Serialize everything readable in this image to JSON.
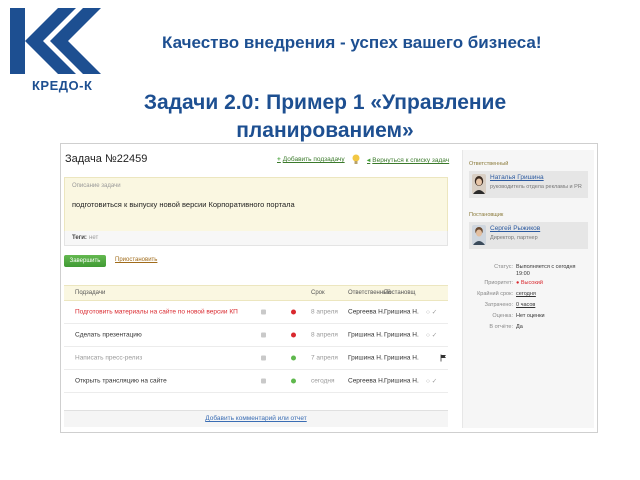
{
  "slide": {
    "logo_text": "КРЕДО-К",
    "slogan": "Качество внедрения - успех вашего бизнеса!",
    "title": "Задачи 2.0: Пример 1 «Управление планированием»"
  },
  "task": {
    "title": "Задача №22459",
    "add_subtask": "Добавить подзадачу",
    "back_to_list": "Вернуться к списку задач",
    "description_label": "Описание задачи",
    "description": "подготовиться к выпуску новой версии Корпоративного портала",
    "tags_label": "Теги:",
    "tags_value": "нет",
    "finish_button": "Завершить",
    "postpone_link": "Приостановить",
    "add_comment": "Добавить комментарий или отчет"
  },
  "subtasks": {
    "headers": {
      "name": "Подзадачи",
      "deadline": "Срок",
      "responsible": "Ответственный",
      "setter": "Постановщ"
    },
    "rows": [
      {
        "name": "Подготовить материалы на сайте по новой версии КП",
        "deadline": "8 апреля",
        "responsible": "Сергеева Н.",
        "setter": "Гришина Н.",
        "status_color": "red",
        "style": "red",
        "flag": false
      },
      {
        "name": "Сделать презентацию",
        "deadline": "8 апреля",
        "responsible": "Гришина Н.",
        "setter": "Гришина Н.",
        "status_color": "red",
        "style": "dark",
        "flag": false
      },
      {
        "name": "Написать пресс-релиз",
        "deadline": "7 апреля",
        "responsible": "Гришина Н.",
        "setter": "Гришина Н.",
        "status_color": "green",
        "style": "gray",
        "flag": true
      },
      {
        "name": "Открыть трансляцию на сайте",
        "deadline": "сегодня",
        "responsible": "Сергеева Н.",
        "setter": "Гришина Н.",
        "status_color": "green",
        "style": "dark",
        "flag": false
      }
    ]
  },
  "sidebar": {
    "responsible_label": "Ответственный",
    "responsible_name": "Наталья Гришина",
    "responsible_role": "руководитель отдела рекламы и PR",
    "setter_label": "Постановщик",
    "setter_name": "Сергей Рыжиков",
    "setter_role": "Директор, партнер",
    "props": [
      {
        "key": "Статус:",
        "value": "Выполняется с сегодня 19:00",
        "style": "plain"
      },
      {
        "key": "Приоритет:",
        "value": "● Высокий",
        "style": "red"
      },
      {
        "key": "Крайний срок:",
        "value": "сегодня",
        "style": "link"
      },
      {
        "key": "Затрачено:",
        "value": "0 часов",
        "style": "link"
      },
      {
        "key": "Оценка:",
        "value": "Нет оценки",
        "style": "plain"
      },
      {
        "key": "В отчёте:",
        "value": "Да",
        "style": "plain"
      }
    ]
  },
  "colors": {
    "brand_blue": "#1d4f91",
    "status_red": "#d9282e",
    "status_green": "#5fb84d",
    "highlight": "#faf7e1"
  }
}
